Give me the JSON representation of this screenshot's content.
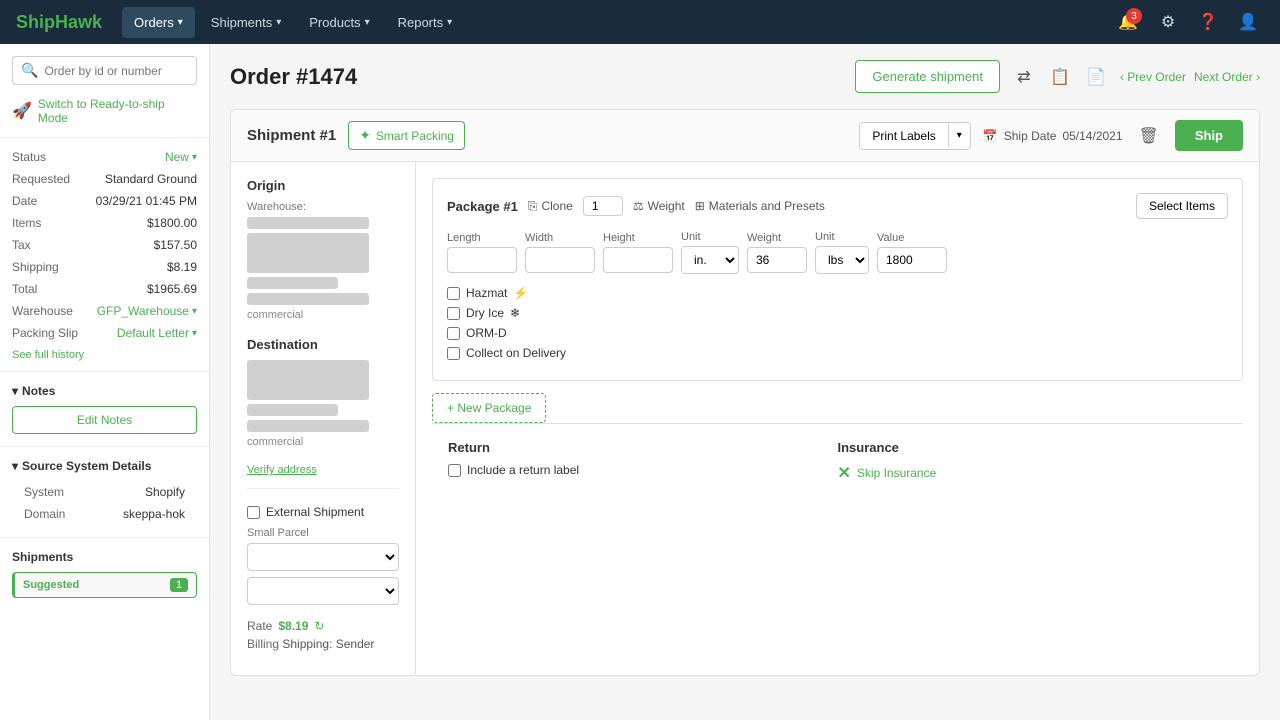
{
  "app": {
    "logo_part1": "Ship",
    "logo_part2": "Hawk"
  },
  "nav": {
    "items": [
      {
        "label": "Orders",
        "active": true
      },
      {
        "label": "Shipments",
        "active": false
      },
      {
        "label": "Products",
        "active": false
      },
      {
        "label": "Reports",
        "active": false
      }
    ],
    "notification_count": "3",
    "icons": {
      "settings": "⚙",
      "help": "?",
      "user": "👤"
    }
  },
  "search": {
    "placeholder": "Order by id or number"
  },
  "sidebar": {
    "ready_to_ship": "Switch to Ready-to-ship Mode",
    "status_label": "Status",
    "status_value": "New",
    "requested_label": "Requested",
    "requested_value": "Standard Ground",
    "date_label": "Date",
    "date_value": "03/29/21 01:45 PM",
    "items_label": "Items",
    "items_value": "$1800.00",
    "tax_label": "Tax",
    "tax_value": "$157.50",
    "shipping_label": "Shipping",
    "shipping_value": "$8.19",
    "total_label": "Total",
    "total_value": "$1965.69",
    "warehouse_label": "Warehouse",
    "warehouse_value": "GFP_Warehouse",
    "packing_label": "Packing Slip",
    "packing_value": "Default Letter",
    "see_history": "See full history",
    "notes_header": "Notes",
    "edit_notes_btn": "Edit Notes",
    "source_header": "Source System Details",
    "system_label": "System",
    "system_value": "Shopify",
    "domain_label": "Domain",
    "domain_value": "skeppa-hok",
    "shipments_label": "Shipments",
    "suggested_label": "Suggested",
    "suggested_count": "1"
  },
  "page": {
    "title": "Order #1474",
    "generate_shipment": "Generate shipment",
    "prev_order": "‹ Prev Order",
    "next_order": "Next Order ›"
  },
  "shipment": {
    "title": "Shipment #1",
    "smart_packing": "Smart Packing",
    "print_labels": "Print Labels",
    "ship_date_label": "Ship Date",
    "ship_date": "05/14/2021",
    "ship_btn": "Ship",
    "origin": {
      "title": "Origin",
      "warehouse_label": "Warehouse:",
      "type": "commercial"
    },
    "destination": {
      "title": "Destination",
      "type": "commercial"
    },
    "verify_address": "Verify address",
    "package": {
      "title": "Package #1",
      "clone_label": "Clone",
      "quantity": "1",
      "weight_label": "Weight",
      "materials_label": "Materials and Presets",
      "select_items": "Select Items",
      "length_label": "Length",
      "width_label": "Width",
      "height_label": "Height",
      "unit_label": "Unit",
      "weight_col_label": "Weight",
      "unit2_label": "Unit",
      "value_label": "Value",
      "length_val": "",
      "width_val": "",
      "height_val": "",
      "unit_val": "in.",
      "weight_val": "36",
      "weight_unit": "lbs",
      "value_val": "1800",
      "hazmat": "Hazmat",
      "dry_ice": "Dry Ice",
      "orm_d": "ORM-D",
      "cod": "Collect on Delivery"
    },
    "new_package_btn": "+ New Package",
    "return": {
      "title": "Return",
      "include_return": "Include a return label"
    },
    "insurance": {
      "title": "Insurance",
      "skip": "Skip Insurance"
    },
    "external_shipment": "External Shipment",
    "small_parcel": "Small Parcel",
    "rate_label": "Rate",
    "rate_value": "$8.19",
    "billing_label": "Billing",
    "billing_value": "Shipping: Sender"
  }
}
